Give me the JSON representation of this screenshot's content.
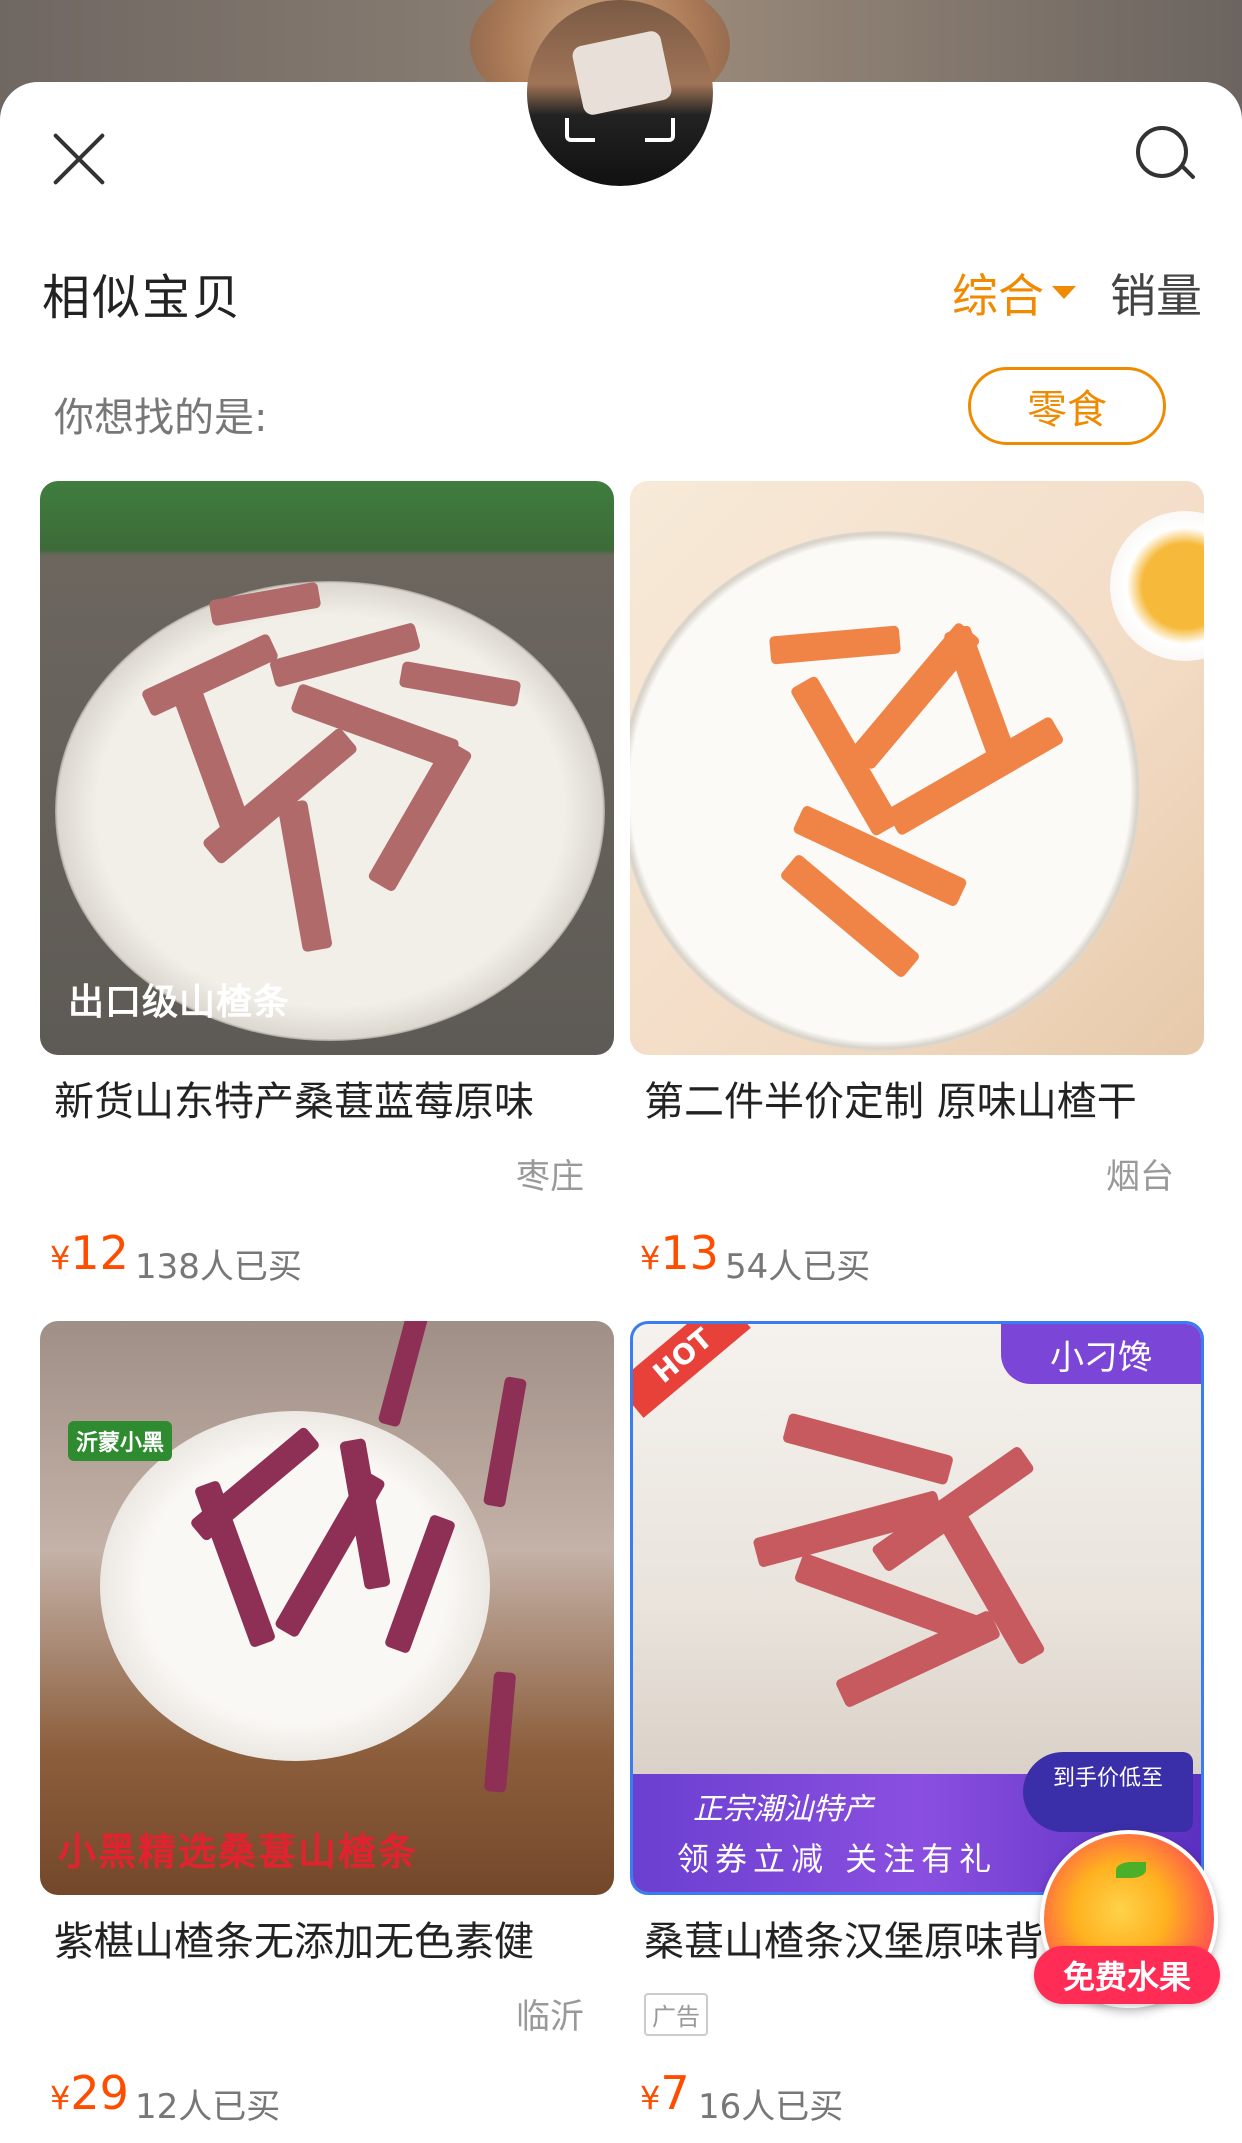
{
  "header": {
    "title": "相似宝贝",
    "sort_options": [
      "综合",
      "销量"
    ]
  },
  "suggestion": {
    "label": "你想找的是:",
    "chip": "零食"
  },
  "products": [
    {
      "name": "新货山东特产桑葚蓝莓原味",
      "location": "枣庄",
      "price_symbol": "¥",
      "price": "12",
      "sold": "138人已买",
      "image_caption": "出口级山楂条"
    },
    {
      "name": "第二件半价定制 原味山楂干",
      "location": "烟台",
      "price_symbol": "¥",
      "price": "13",
      "sold": "54人已买"
    },
    {
      "name": "紫椹山楂条无添加无色素健",
      "location": "临沂",
      "price_symbol": "¥",
      "price": "29",
      "sold": "12人已买",
      "image_logo": "沂蒙小黑",
      "image_caption": "小黑精选桑葚山楂条"
    },
    {
      "name": "桑葚山楂条汉堡原味背",
      "ad_tag": "广告",
      "price_symbol": "¥",
      "price": "7",
      "sold": "16人已买",
      "image_hot": "HOT",
      "image_brand": "小刁馋",
      "image_banner_line1": "正宗潮汕特产",
      "image_banner_line2": "领券立减 关注有礼",
      "image_badge": "到手价低至"
    }
  ],
  "floating": {
    "label": "免费水果"
  },
  "colors": {
    "accent": "#f08a00",
    "price": "#ff4d00"
  }
}
